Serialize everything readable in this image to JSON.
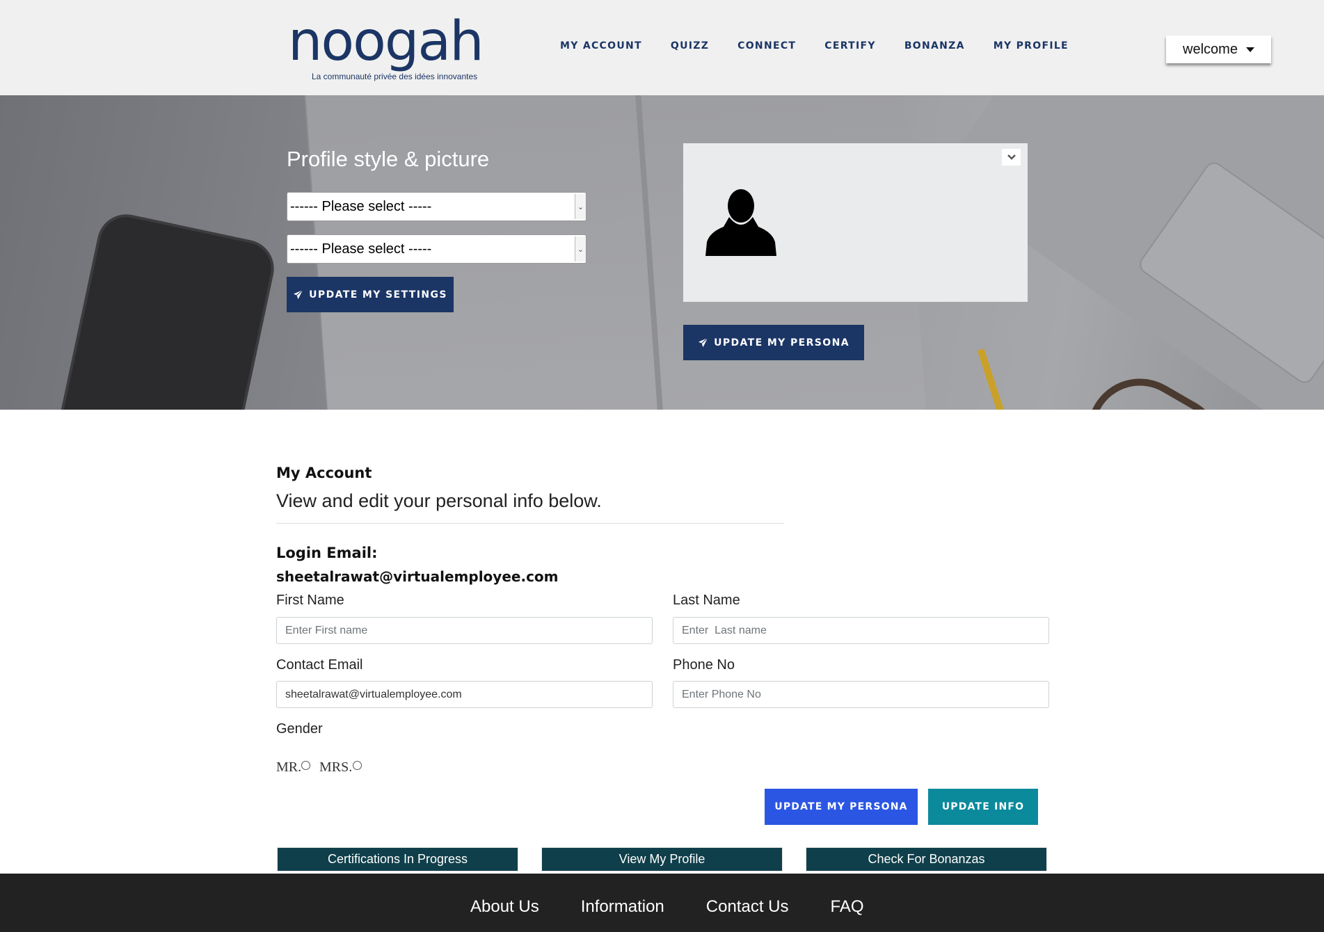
{
  "header": {
    "logo_text": "noogah",
    "tagline": "La communauté privée des idées innovantes",
    "nav": [
      {
        "label": "MY ACCOUNT"
      },
      {
        "label": "QUIZZ"
      },
      {
        "label": "CONNECT"
      },
      {
        "label": "CERTIFY"
      },
      {
        "label": "BONANZA"
      },
      {
        "label": "MY PROFILE"
      }
    ],
    "user_menu_label": "welcome"
  },
  "hero": {
    "title": "Profile style & picture",
    "select_1_value": "------ Please select -----",
    "select_2_value": "------ Please select -----",
    "update_settings_label": "UPDATE MY SETTINGS",
    "update_persona_label": "UPDATE MY PERSONA",
    "icons": {
      "send": "paper-plane-icon",
      "toggle": "chevron-down-icon",
      "avatar": "user-silhouette-icon"
    }
  },
  "account": {
    "title": "My Account",
    "subtitle": "View and edit your personal info below.",
    "login_email_label": "Login Email:",
    "login_email_value": "sheetalrawat@virtualemployee.com",
    "first_name": {
      "label": "First Name",
      "placeholder": "Enter First name",
      "value": ""
    },
    "last_name": {
      "label": "Last Name",
      "placeholder": "Enter  Last name",
      "value": ""
    },
    "contact_email": {
      "label": "Contact Email",
      "placeholder": "",
      "value": "sheetalrawat@virtualemployee.com"
    },
    "phone": {
      "label": "Phone No",
      "placeholder": "Enter Phone No",
      "value": ""
    },
    "gender_label": "Gender",
    "gender_options": [
      {
        "label": "MR."
      },
      {
        "label": "MRS."
      }
    ],
    "update_persona_label": "UPDATE MY PERSONA",
    "update_info_label": "UPDATE INFO",
    "quick_links": [
      {
        "label": "Certifications In Progress"
      },
      {
        "label": "View My Profile"
      },
      {
        "label": "Check For Bonanzas"
      }
    ]
  },
  "footer": {
    "links": [
      {
        "label": "About Us"
      },
      {
        "label": "Information"
      },
      {
        "label": "Contact Us"
      },
      {
        "label": "FAQ"
      }
    ]
  },
  "colors": {
    "brand_navy": "#1b3565",
    "update_persona_blue": "#2b56e4",
    "update_info_teal": "#0b8a9c",
    "quick_link_dark_teal": "#0f3f4a",
    "footer_bg": "#222222"
  }
}
